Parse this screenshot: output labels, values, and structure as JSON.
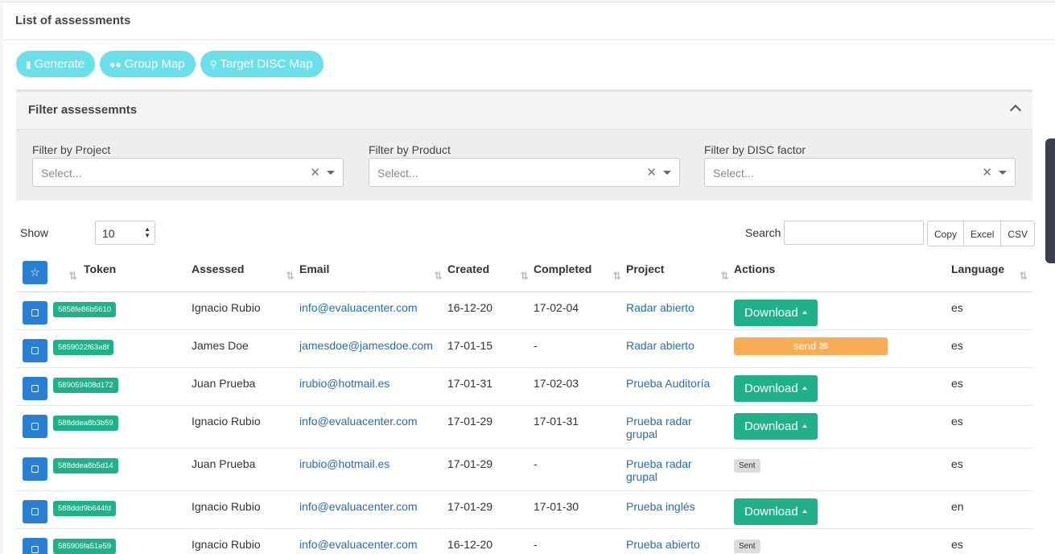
{
  "page": {
    "title": "List of assessments"
  },
  "toolbar": {
    "generate_label": "Generate",
    "group_map_label": "Group Map",
    "target_disc_label": "Target DISC Map"
  },
  "filters": {
    "title": "Filter assessemnts",
    "project_label": "Filter by Project",
    "product_label": "Filter by Product",
    "disc_label": "Filter by DISC factor",
    "placeholder": "Select..."
  },
  "table_controls": {
    "show_label": "Show",
    "show_value": "10",
    "search_label": "Search",
    "copy": "Copy",
    "excel": "Excel",
    "csv": "CSV"
  },
  "columns": [
    "Token",
    "Assessed",
    "Email",
    "Created",
    "Completed",
    "Project",
    "Actions",
    "Language"
  ],
  "rows": [
    {
      "token": "5858fe86b5610",
      "assessed": "Ignacio Rubio",
      "email": "info@evaluacenter.com",
      "created": "16-12-20",
      "completed": "17-02-04",
      "project": "Radar abierto",
      "action": "Download",
      "language": "es"
    },
    {
      "token": "5859022f63a8f",
      "assessed": "James Doe",
      "email": "jamesdoe@jamesdoe.com",
      "created": "17-01-15",
      "completed": "-",
      "project": "Radar abierto",
      "action": "send",
      "language": "es"
    },
    {
      "token": "589059408d172",
      "assessed": "Juan Prueba",
      "email": "irubio@hotmail.es",
      "created": "17-01-31",
      "completed": "17-02-03",
      "project": "Prueba Auditoría",
      "action": "Download",
      "language": "es"
    },
    {
      "token": "588ddea8b3b59",
      "assessed": "Ignacio Rubio",
      "email": "info@evaluacenter.com",
      "created": "17-01-29",
      "completed": "17-01-31",
      "project": "Prueba radar grupal",
      "action": "Download",
      "language": "es"
    },
    {
      "token": "588ddea8b5d14",
      "assessed": "Juan Prueba",
      "email": "irubio@hotmail.es",
      "created": "17-01-29",
      "completed": "-",
      "project": "Prueba radar grupal",
      "action": "Sent",
      "language": "es"
    },
    {
      "token": "588ddd9b644fd",
      "assessed": "Ignacio Rubio",
      "email": "info@evaluacenter.com",
      "created": "17-01-29",
      "completed": "17-01-30",
      "project": "Prueba inglés",
      "action": "Download",
      "language": "en"
    },
    {
      "token": "585906fa51e59",
      "assessed": "Ignacio Rubio",
      "email": "info@evaluacenter.com",
      "created": "16-12-20",
      "completed": "-",
      "project": "Prueba abierto",
      "action": "Sent",
      "language": "es"
    }
  ]
}
